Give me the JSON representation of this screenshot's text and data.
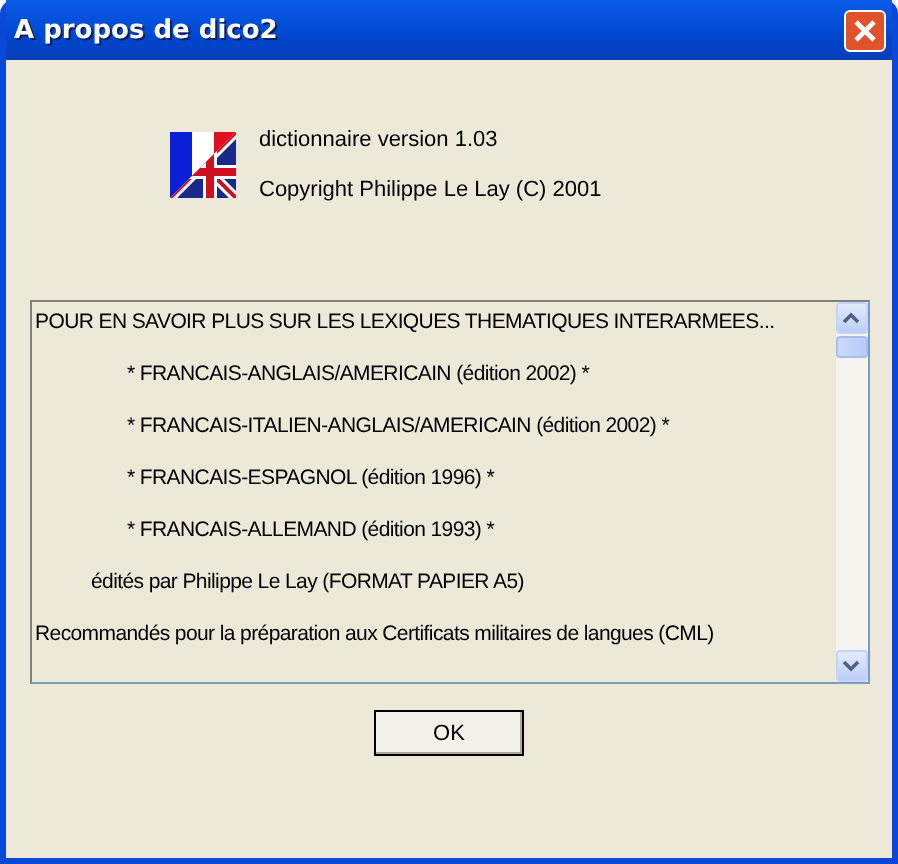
{
  "window": {
    "title": "A propos de dico2"
  },
  "about": {
    "version": "dictionnaire version 1.03",
    "copyright": "Copyright  Philippe Le Lay (C) 2001"
  },
  "text_area": {
    "lines": [
      {
        "kind": "plain",
        "text": "POUR EN SAVOIR PLUS SUR LES LEXIQUES THEMATIQUES INTERARMEES..."
      },
      {
        "kind": "item",
        "text": "* FRANCAIS-ANGLAIS/AMERICAIN (édition 2002) *"
      },
      {
        "kind": "item",
        "text": "* FRANCAIS-ITALIEN-ANGLAIS/AMERICAIN (édition 2002) *"
      },
      {
        "kind": "item",
        "text": "* FRANCAIS-ESPAGNOL (édition 1996) *"
      },
      {
        "kind": "item",
        "text": "* FRANCAIS-ALLEMAND (édition 1993) *"
      },
      {
        "kind": "note",
        "text": "édités par Philippe Le Lay (FORMAT PAPIER A5)"
      },
      {
        "kind": "plain",
        "text": "Recommandés pour la préparation aux Certificats militaires de langues (CML)"
      }
    ]
  },
  "buttons": [
    "OK"
  ]
}
